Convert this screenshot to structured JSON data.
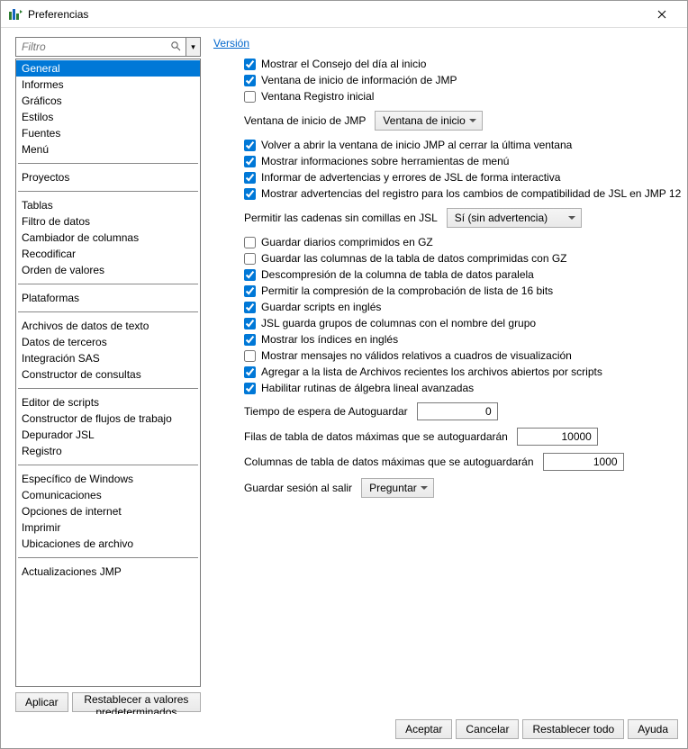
{
  "window": {
    "title": "Preferencias"
  },
  "filter": {
    "placeholder": "Filtro"
  },
  "categories": {
    "groups": [
      [
        "General",
        "Informes",
        "Gráficos",
        "Estilos",
        "Fuentes",
        "Menú"
      ],
      [
        "Proyectos"
      ],
      [
        "Tablas",
        "Filtro de datos",
        "Cambiador de columnas",
        "Recodificar",
        "Orden de valores"
      ],
      [
        "Plataformas"
      ],
      [
        "Archivos de datos de texto",
        "Datos de terceros",
        "Integración SAS",
        "Constructor de consultas"
      ],
      [
        "Editor de scripts",
        "Constructor de flujos de trabajo",
        "Depurador JSL",
        "Registro"
      ],
      [
        "Específico de Windows",
        "Comunicaciones",
        "Opciones de internet",
        "Imprimir",
        "Ubicaciones de archivo"
      ],
      [
        "Actualizaciones JMP"
      ]
    ],
    "selected": "General"
  },
  "left_buttons": {
    "apply": "Aplicar",
    "reset_defaults": "Restablecer a valores predeterminados"
  },
  "header": {
    "version_link": "Versión"
  },
  "options": {
    "tip_on_start": {
      "checked": true,
      "label": "Mostrar el Consejo del día al inicio"
    },
    "info_start_window": {
      "checked": true,
      "label": "Ventana de inicio de información de JMP"
    },
    "initial_log_window": {
      "checked": false,
      "label": "Ventana Registro inicial"
    },
    "start_window_label": "Ventana de inicio de JMP",
    "start_window_value": "Ventana de inicio",
    "reopen_on_close": {
      "checked": true,
      "label": "Volver a abrir la ventana de inicio JMP al cerrar la última ventana"
    },
    "menu_tooltips": {
      "checked": true,
      "label": "Mostrar informaciones sobre herramientas de menú"
    },
    "jsl_interactive": {
      "checked": true,
      "label": "Informar de advertencias y errores de JSL de forma interactiva"
    },
    "jsl_compat_warn": {
      "checked": true,
      "label": "Mostrar advertencias del registro para los cambios de compatibilidad de JSL en JMP 12"
    },
    "jsl_unquoted_label": "Permitir las cadenas sin comillas en JSL",
    "jsl_unquoted_value": "Sí (sin advertencia)",
    "gz_journals": {
      "checked": false,
      "label": "Guardar diarios comprimidos en GZ"
    },
    "gz_cols": {
      "checked": false,
      "label": "Guardar las columnas de la tabla de datos comprimidas con GZ"
    },
    "parallel_decomp": {
      "checked": true,
      "label": "Descompresión de la columna de tabla de datos paralela"
    },
    "sixteen_bit": {
      "checked": true,
      "label": "Permitir la compresión de la comprobación de lista de 16 bits"
    },
    "scripts_english": {
      "checked": true,
      "label": "Guardar scripts en inglés"
    },
    "jsl_group_name": {
      "checked": true,
      "label": "JSL guarda grupos de columnas con el nombre del grupo"
    },
    "indices_english": {
      "checked": true,
      "label": "Mostrar los índices en inglés"
    },
    "invalid_dbox_msgs": {
      "checked": false,
      "label": "Mostrar mensajes no válidos relativos a cuadros de visualización"
    },
    "recent_files_scripts": {
      "checked": true,
      "label": "Agregar a la lista de Archivos recientes los archivos abiertos por scripts"
    },
    "adv_linear_algebra": {
      "checked": true,
      "label": "Habilitar rutinas de álgebra lineal avanzadas"
    },
    "autosave_timeout_label": "Tiempo de espera de Autoguardar",
    "autosave_timeout_value": "0",
    "autosave_rows_label": "Filas de tabla de datos máximas que se autoguardarán",
    "autosave_rows_value": "10000",
    "autosave_cols_label": "Columnas de tabla de datos máximas que se autoguardarán",
    "autosave_cols_value": "1000",
    "save_session_label": "Guardar sesión al salir",
    "save_session_value": "Preguntar"
  },
  "bottom": {
    "ok": "Aceptar",
    "cancel": "Cancelar",
    "reset_all": "Restablecer todo",
    "help": "Ayuda"
  }
}
